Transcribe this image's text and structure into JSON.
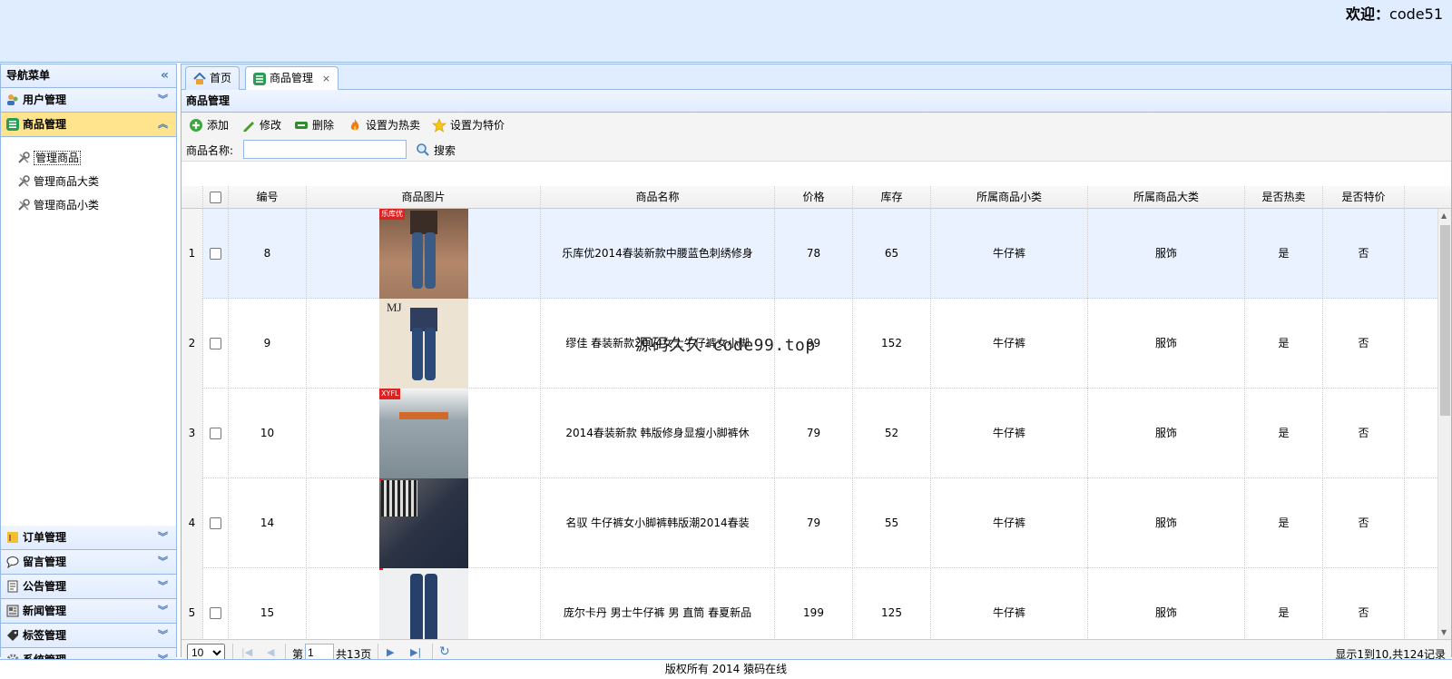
{
  "header": {
    "welcome_label": "欢迎：",
    "username": "code51"
  },
  "nav": {
    "title": "导航菜单",
    "sections": [
      {
        "label": "用户管理",
        "icon": "user-icon"
      },
      {
        "label": "商品管理",
        "icon": "list-icon",
        "active": true
      },
      {
        "label": "订单管理",
        "icon": "order-icon"
      },
      {
        "label": "留言管理",
        "icon": "message-icon"
      },
      {
        "label": "公告管理",
        "icon": "notice-icon"
      },
      {
        "label": "新闻管理",
        "icon": "news-icon"
      },
      {
        "label": "标签管理",
        "icon": "tag-icon"
      },
      {
        "label": "系统管理",
        "icon": "gear-icon"
      }
    ],
    "goods_items": [
      {
        "label": "管理商品",
        "selected": true
      },
      {
        "label": "管理商品大类"
      },
      {
        "label": "管理商品小类"
      }
    ]
  },
  "tabs": [
    {
      "label": "首页",
      "icon": "home-icon"
    },
    {
      "label": "商品管理",
      "icon": "list-icon",
      "active": true,
      "close": "×"
    }
  ],
  "panel": {
    "title": "商品管理",
    "toolbar": {
      "add": "添加",
      "edit": "修改",
      "delete": "删除",
      "set_hot": "设置为热卖",
      "set_special": "设置为特价"
    },
    "search": {
      "label": "商品名称:",
      "value": "",
      "button": "搜索"
    }
  },
  "grid": {
    "columns": [
      "编号",
      "商品图片",
      "商品名称",
      "价格",
      "库存",
      "所属商品小类",
      "所属商品大类",
      "是否热卖",
      "是否特价"
    ],
    "rows": [
      {
        "num": "1",
        "id": "8",
        "name": "乐库优2014春装新款中腰蓝色刺绣修身",
        "price": "78",
        "stock": "65",
        "sub": "牛仔裤",
        "cat": "服饰",
        "hot": "是",
        "special": "否",
        "img_tag": "乐库优"
      },
      {
        "num": "2",
        "id": "9",
        "name": "缪佳 春装新款2014女士牛仔裤女小脚",
        "price": "99",
        "stock": "152",
        "sub": "牛仔裤",
        "cat": "服饰",
        "hot": "是",
        "special": "否",
        "img_tag": "MJ"
      },
      {
        "num": "3",
        "id": "10",
        "name": "2014春装新款 韩版修身显瘦小脚裤休",
        "price": "79",
        "stock": "52",
        "sub": "牛仔裤",
        "cat": "服饰",
        "hot": "是",
        "special": "否",
        "img_tag": "XYFL"
      },
      {
        "num": "4",
        "id": "14",
        "name": "名驭 牛仔裤女小脚裤韩版潮2014春装",
        "price": "79",
        "stock": "55",
        "sub": "牛仔裤",
        "cat": "服饰",
        "hot": "是",
        "special": "否",
        "img_tag": ""
      },
      {
        "num": "5",
        "id": "15",
        "name": "庞尔卡丹 男士牛仔裤 男 直筒 春夏新品",
        "price": "199",
        "stock": "125",
        "sub": "牛仔裤",
        "cat": "服饰",
        "hot": "是",
        "special": "否",
        "img_tag": ""
      }
    ]
  },
  "watermark": "源码久久-code99.top",
  "pager": {
    "page_size": "10",
    "page_prefix": "第",
    "page_value": "1",
    "page_suffix": "共13页",
    "info": "显示1到10,共124记录"
  },
  "footer": "版权所有 2014 猿码在线"
}
